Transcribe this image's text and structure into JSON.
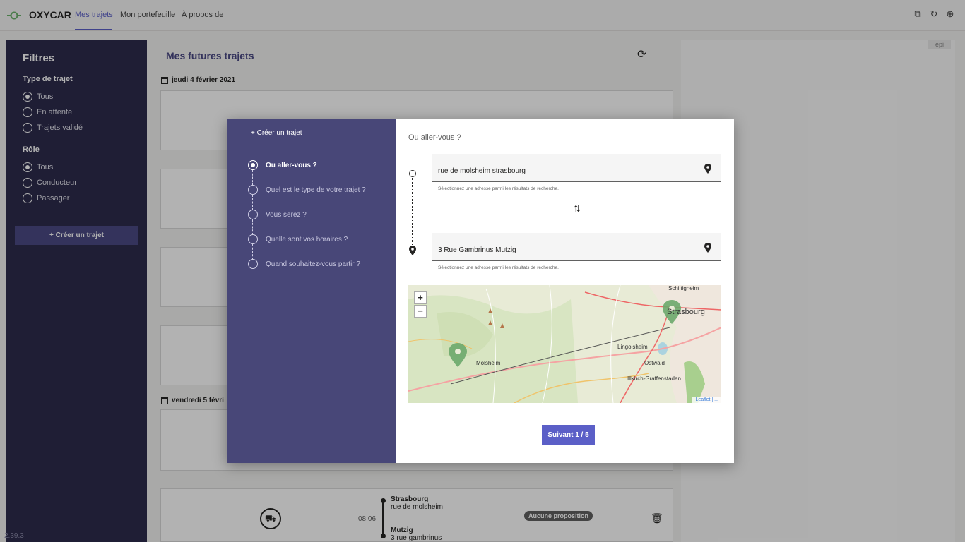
{
  "app": {
    "brand": "OXYCAR",
    "tabs": [
      "Mes trajets",
      "Mon portefeuille",
      "À propos de"
    ],
    "active_tab": "Mes trajets",
    "top_icons": [
      "popout-icon",
      "reload-icon",
      "globe-icon"
    ],
    "epi": "epi",
    "version": "2.39.3",
    "accent_color": "#5b5fc7",
    "sidebar_color": "#2d2c4d"
  },
  "sidebar": {
    "title": "Filtres",
    "trip_type_label": "Type de trajet",
    "trip_type_options": [
      {
        "label": "Tous",
        "selected": true
      },
      {
        "label": "En attente",
        "selected": false
      },
      {
        "label": "Trajets validé",
        "selected": false
      }
    ],
    "role_label": "Rôle",
    "role_options": [
      {
        "label": "Tous",
        "selected": true
      },
      {
        "label": "Conducteur",
        "selected": false
      },
      {
        "label": "Passager",
        "selected": false
      }
    ],
    "create_button": "+ Créer un trajet"
  },
  "main": {
    "title": "Mes futures trajets",
    "dates": [
      "jeudi 4 février 2021",
      "vendredi 5 févri"
    ],
    "trips": [
      {
        "from_city": "Strasbourg",
        "from_street": "rue de molsheim",
        "time": "08:06",
        "to_city": "Mutzig",
        "to_street": "3 rue gambrinus",
        "status": "Aucune proposition"
      }
    ]
  },
  "modal": {
    "title": "+ Créer un trajet",
    "steps": [
      {
        "label": "Ou aller-vous ?",
        "active": true
      },
      {
        "label": "Quel est le type de votre trajet ?",
        "active": false
      },
      {
        "label": "Vous serez ?",
        "active": false
      },
      {
        "label": "Quelle sont vos horaires ?",
        "active": false
      },
      {
        "label": "Quand souhaitez-vous partir ?",
        "active": false
      }
    ],
    "question": "Ou aller-vous ?",
    "from_value": "rue de molsheim strasbourg",
    "to_value": "3 Rue Gambrinus Mutzig",
    "hint": "Sélectionnez une adresse parmi les résultats de recherche.",
    "map": {
      "zoom_in": "+",
      "zoom_out": "−",
      "places": [
        "Schiltigheim",
        "Strasbourg",
        "Lingolsheim",
        "Molsheim",
        "Ostwald",
        "Illkirch-Graffenstaden"
      ],
      "attribution": "Leaflet | ..."
    },
    "next_button": "Suivant 1 / 5"
  }
}
